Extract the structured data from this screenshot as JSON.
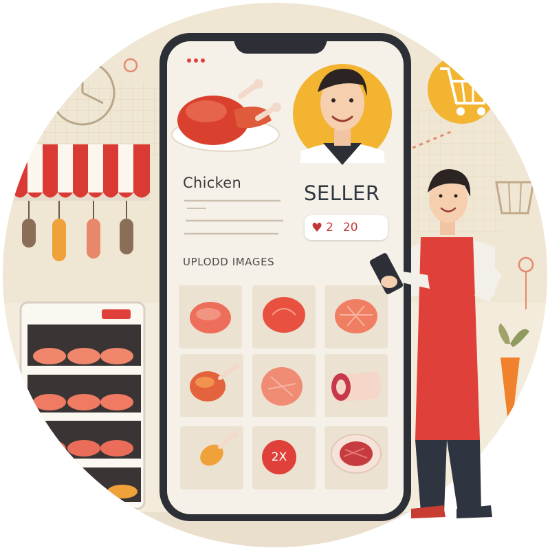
{
  "product": {
    "title": "Chicken"
  },
  "seller": {
    "label": "SELLER"
  },
  "stats": {
    "likes": "2",
    "count": "20"
  },
  "upload": {
    "label": "UPLODD IMAGES"
  },
  "grid": {
    "tiles": [
      {
        "icon": "meat-slice-icon"
      },
      {
        "icon": "steak-icon"
      },
      {
        "icon": "salmon-steak-icon"
      },
      {
        "icon": "roast-chicken-icon"
      },
      {
        "icon": "ham-slice-icon"
      },
      {
        "icon": "pork-cut-icon"
      },
      {
        "icon": "drumstick-icon"
      },
      {
        "icon": "multiplier-badge",
        "badge": "2X"
      },
      {
        "icon": "beef-cut-icon"
      }
    ]
  },
  "colors": {
    "accent": "#e0403a",
    "background": "#efe6d3",
    "phone_frame": "#2d2f36",
    "gold": "#f2b431"
  }
}
